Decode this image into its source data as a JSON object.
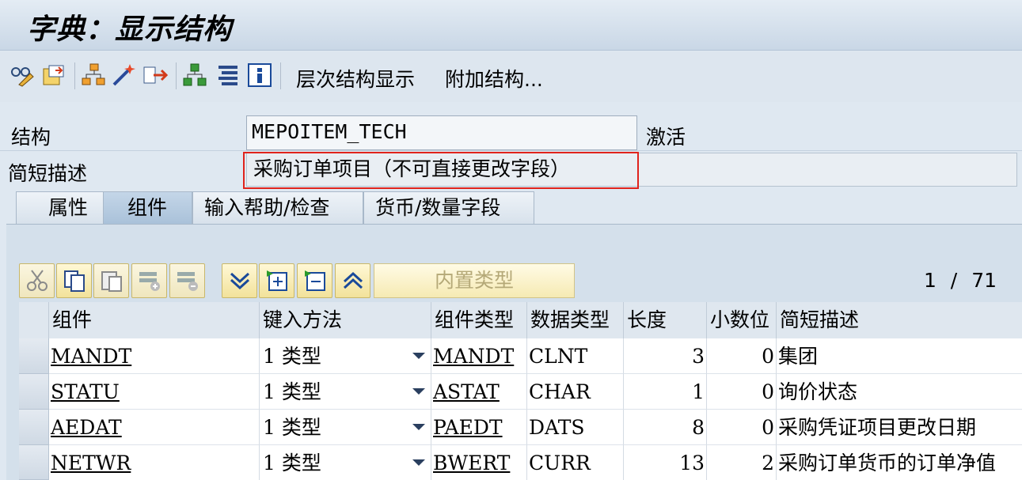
{
  "window": {
    "title": "字典：显示结构"
  },
  "toolbar": {
    "icons": [
      "glasses-edit-icon",
      "other-object-icon",
      "hierarchy-icon",
      "magic-wand-icon",
      "where-used-icon",
      "object-tree-icon",
      "display-list-icon",
      "info-icon"
    ],
    "hierarchy_display": "层次结构显示",
    "append_structure": "附加结构..."
  },
  "header": {
    "structure_label": "结构",
    "structure_value": "MEPOITEM_TECH",
    "status": "激活",
    "short_desc_label": "简短描述",
    "short_desc_value": "采购订单项目（不可直接更改字段）"
  },
  "tabs": [
    {
      "label": "属性"
    },
    {
      "label": "组件"
    },
    {
      "label": "输入帮助/检查"
    },
    {
      "label": "货币/数量字段"
    }
  ],
  "table_toolbar": {
    "builtin_type": "内置类型",
    "page_current": "1",
    "page_sep": "/",
    "page_total": "71"
  },
  "table": {
    "columns": [
      "组件",
      "键入方法",
      "组件类型",
      "数据类型",
      "长度",
      "小数位",
      "简短描述"
    ],
    "rows": [
      {
        "component": "MANDT",
        "typing": "1  类型",
        "comp_type": "MANDT",
        "data_type": "CLNT",
        "length": "3",
        "decimals": "0",
        "desc": "集团"
      },
      {
        "component": "STATU",
        "typing": "1  类型",
        "comp_type": "ASTAT",
        "data_type": "CHAR",
        "length": "1",
        "decimals": "0",
        "desc": "询价状态"
      },
      {
        "component": "AEDAT",
        "typing": "1  类型",
        "comp_type": "PAEDT",
        "data_type": "DATS",
        "length": "8",
        "decimals": "0",
        "desc": "采购凭证项目更改日期"
      },
      {
        "component": "NETWR",
        "typing": "1  类型",
        "comp_type": "BWERT",
        "data_type": "CURR",
        "length": "13",
        "decimals": "2",
        "desc": "采购订单货币的订单净值"
      }
    ]
  },
  "colors": {
    "highlight_frame": "#e0231c",
    "button_yellow": "#f6eab3"
  }
}
